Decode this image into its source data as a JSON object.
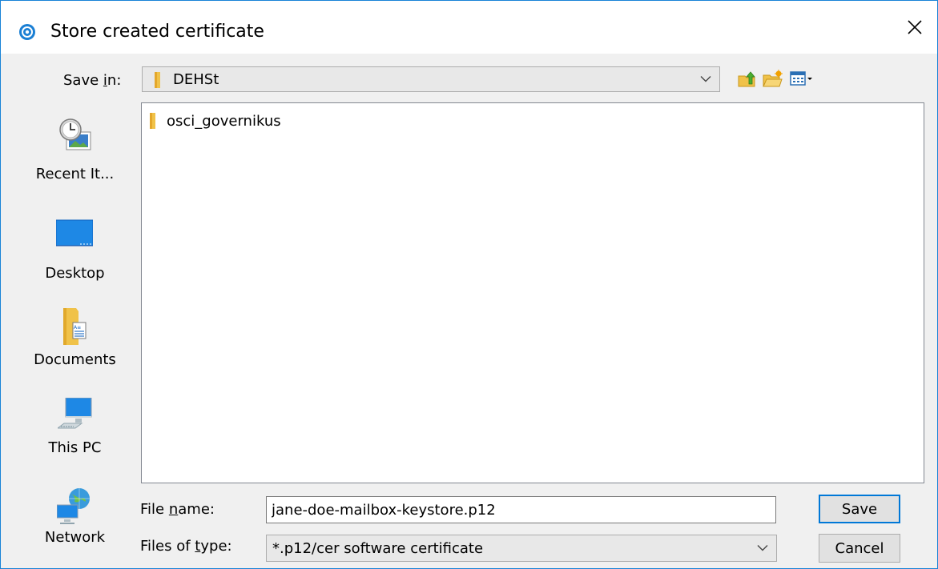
{
  "window": {
    "title": "Store created certificate",
    "icon": "app-info-icon",
    "close": "close-icon"
  },
  "toolbar": {
    "save_in_label_pre": "Save ",
    "save_in_label_u": "i",
    "save_in_label_post": "n:",
    "location": "DEHSt",
    "icons": [
      "up-folder-icon",
      "new-folder-icon",
      "view-menu-icon"
    ]
  },
  "places": [
    {
      "label": "Recent It...",
      "icon": "recent-items-icon"
    },
    {
      "label": "Desktop",
      "icon": "desktop-icon"
    },
    {
      "label": "Documents",
      "icon": "documents-icon"
    },
    {
      "label": "This PC",
      "icon": "this-pc-icon"
    },
    {
      "label": "Network",
      "icon": "network-icon"
    }
  ],
  "files": [
    {
      "name": "osci_governikus",
      "type": "folder"
    }
  ],
  "form": {
    "file_name_label_pre": "File ",
    "file_name_label_u": "n",
    "file_name_label_post": "ame:",
    "file_name_value": "jane-doe-mailbox-keystore.p12",
    "file_type_label_pre": "Files of ",
    "file_type_label_u": "t",
    "file_type_label_post": "ype:",
    "file_type_value": "*.p12/cer software certificate"
  },
  "buttons": {
    "save": "Save",
    "cancel": "Cancel"
  },
  "colors": {
    "accent": "#0078d7",
    "window_border": "#1883d7",
    "folder": "#f0c249"
  }
}
